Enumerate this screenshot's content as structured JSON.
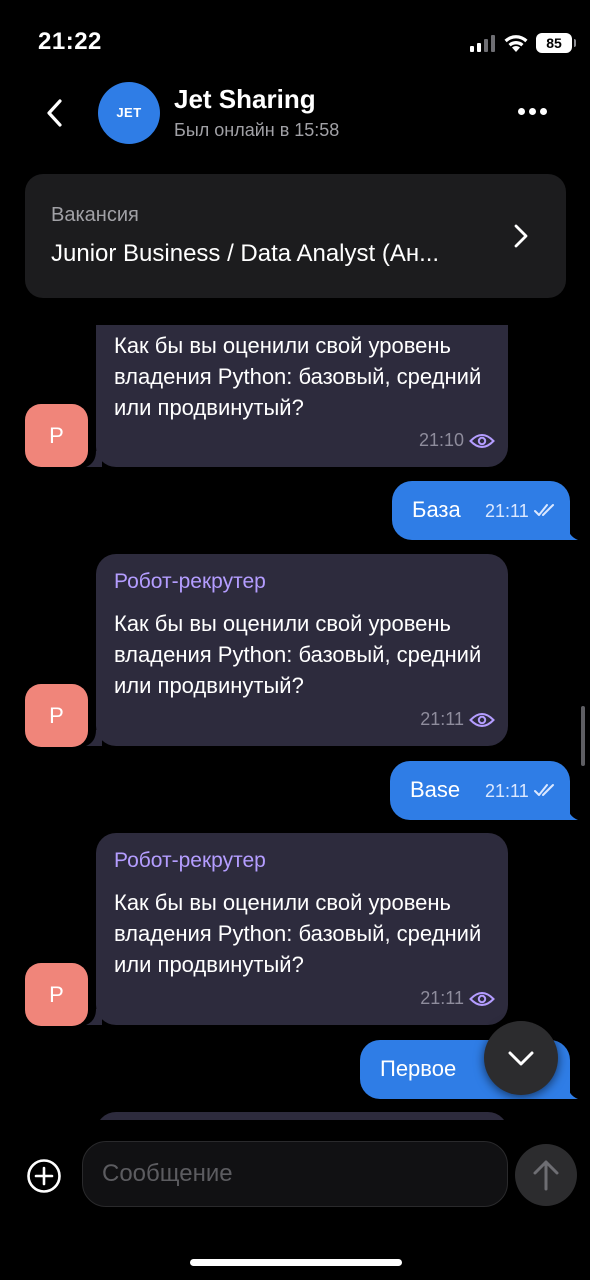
{
  "status_bar": {
    "time": "21:22",
    "battery": "85"
  },
  "header": {
    "avatar_text": "JET",
    "title": "Jet Sharing",
    "subtitle": "Был онлайн в 15:58"
  },
  "vacancy": {
    "label": "Вакансия",
    "title": "Junior Business / Data Analyst (Ан..."
  },
  "messages": [
    {
      "direction": "in",
      "sender": "",
      "text": "Как бы вы оценили свой уровень владения Python: базовый, средний или продвинутый?",
      "time": "21:10",
      "avatar": "Р"
    },
    {
      "direction": "out",
      "text": "База",
      "time": "21:11"
    },
    {
      "direction": "in",
      "sender": "Робот-рекрутер",
      "text": "Как бы вы оценили свой уровень владения Python: базовый, средний или продвинутый?",
      "time": "21:11",
      "avatar": "Р"
    },
    {
      "direction": "out",
      "text": "Base",
      "time": "21:11"
    },
    {
      "direction": "in",
      "sender": "Робот-рекрутер",
      "text": "Как бы вы оценили свой уровень владения Python: базовый, средний или продвинутый?",
      "time": "21:11",
      "avatar": "Р"
    },
    {
      "direction": "out",
      "text": "Первое",
      "time": ""
    }
  ],
  "composer": {
    "placeholder": "Сообщение"
  },
  "icons": {
    "back": "chevron-left-icon",
    "more": "more-horizontal-icon",
    "vacancy_open": "chevron-right-icon",
    "seen": "eye-icon",
    "delivered": "double-check-icon",
    "scroll_down": "chevron-down-icon",
    "add": "plus-circle-icon",
    "send": "arrow-up-icon"
  },
  "colors": {
    "accent": "#2f7de6",
    "incoming_bubble": "#2d2b3d",
    "sender_name": "#b49dff",
    "bot_avatar": "#f0857a",
    "background": "#000000"
  }
}
